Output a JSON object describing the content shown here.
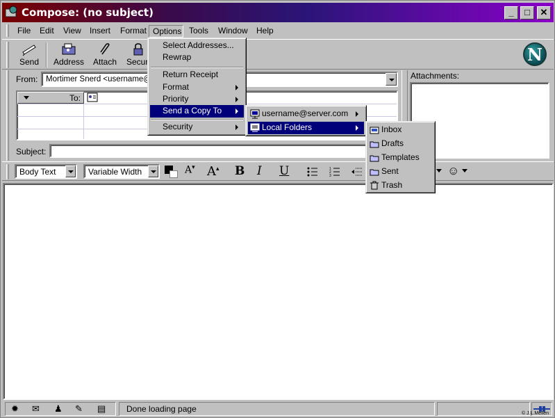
{
  "window": {
    "title": "Compose: (no subject)",
    "minimize": "_",
    "maximize": "□",
    "close": "✕"
  },
  "menubar": {
    "items": [
      "File",
      "Edit",
      "View",
      "Insert",
      "Format",
      "Options",
      "Tools",
      "Window",
      "Help"
    ]
  },
  "toolbar": {
    "send": "Send",
    "address": "Address",
    "attach": "Attach",
    "security": "Securi",
    "logo": "N"
  },
  "header": {
    "from_label": "From:",
    "from_value": "Mortimer Snerd <username@se",
    "to_label": "To:",
    "subject_label": "Subject:",
    "attachments_label": "Attachments:"
  },
  "format_bar": {
    "style": "Body Text",
    "font": "Variable Width",
    "bold": "B",
    "italic": "I",
    "underline": "U"
  },
  "options_menu": {
    "items": [
      {
        "label": "Select Addresses...",
        "submenu": false
      },
      {
        "label": "Rewrap",
        "submenu": false
      },
      {
        "label": "Return Receipt",
        "submenu": false
      },
      {
        "label": "Format",
        "submenu": true
      },
      {
        "label": "Priority",
        "submenu": true
      },
      {
        "label": "Send a Copy To",
        "submenu": true
      },
      {
        "label": "Security",
        "submenu": true
      }
    ]
  },
  "copy_submenu": {
    "items": [
      {
        "label": "username@server.com"
      },
      {
        "label": "Local Folders"
      }
    ]
  },
  "folders_submenu": {
    "items": [
      {
        "label": "Inbox"
      },
      {
        "label": "Drafts"
      },
      {
        "label": "Templates"
      },
      {
        "label": "Sent"
      },
      {
        "label": "Trash"
      }
    ]
  },
  "status": {
    "text": "Done loading page",
    "credit": "© J.L.Mellen"
  },
  "colors": {
    "selection": "#00007b",
    "face": "#c0c0c0"
  }
}
